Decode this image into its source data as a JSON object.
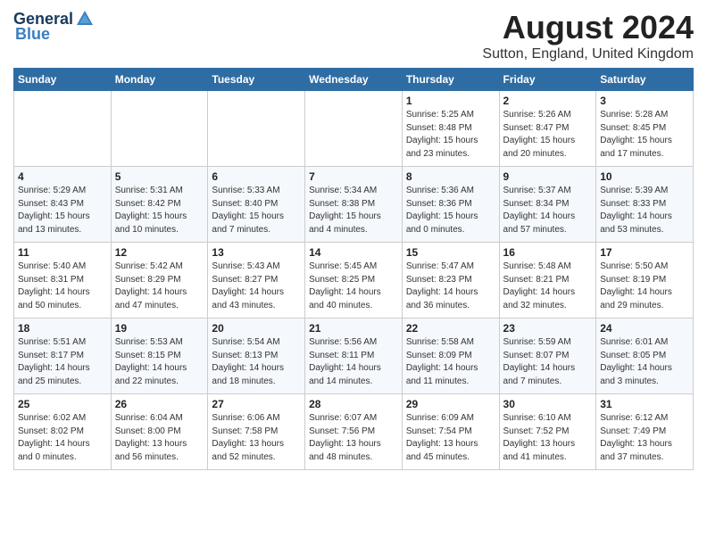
{
  "logo": {
    "general": "General",
    "blue": "Blue"
  },
  "title": "August 2024",
  "location": "Sutton, England, United Kingdom",
  "days_header": [
    "Sunday",
    "Monday",
    "Tuesday",
    "Wednesday",
    "Thursday",
    "Friday",
    "Saturday"
  ],
  "weeks": [
    [
      {
        "day": "",
        "info": ""
      },
      {
        "day": "",
        "info": ""
      },
      {
        "day": "",
        "info": ""
      },
      {
        "day": "",
        "info": ""
      },
      {
        "day": "1",
        "info": "Sunrise: 5:25 AM\nSunset: 8:48 PM\nDaylight: 15 hours\nand 23 minutes."
      },
      {
        "day": "2",
        "info": "Sunrise: 5:26 AM\nSunset: 8:47 PM\nDaylight: 15 hours\nand 20 minutes."
      },
      {
        "day": "3",
        "info": "Sunrise: 5:28 AM\nSunset: 8:45 PM\nDaylight: 15 hours\nand 17 minutes."
      }
    ],
    [
      {
        "day": "4",
        "info": "Sunrise: 5:29 AM\nSunset: 8:43 PM\nDaylight: 15 hours\nand 13 minutes."
      },
      {
        "day": "5",
        "info": "Sunrise: 5:31 AM\nSunset: 8:42 PM\nDaylight: 15 hours\nand 10 minutes."
      },
      {
        "day": "6",
        "info": "Sunrise: 5:33 AM\nSunset: 8:40 PM\nDaylight: 15 hours\nand 7 minutes."
      },
      {
        "day": "7",
        "info": "Sunrise: 5:34 AM\nSunset: 8:38 PM\nDaylight: 15 hours\nand 4 minutes."
      },
      {
        "day": "8",
        "info": "Sunrise: 5:36 AM\nSunset: 8:36 PM\nDaylight: 15 hours\nand 0 minutes."
      },
      {
        "day": "9",
        "info": "Sunrise: 5:37 AM\nSunset: 8:34 PM\nDaylight: 14 hours\nand 57 minutes."
      },
      {
        "day": "10",
        "info": "Sunrise: 5:39 AM\nSunset: 8:33 PM\nDaylight: 14 hours\nand 53 minutes."
      }
    ],
    [
      {
        "day": "11",
        "info": "Sunrise: 5:40 AM\nSunset: 8:31 PM\nDaylight: 14 hours\nand 50 minutes."
      },
      {
        "day": "12",
        "info": "Sunrise: 5:42 AM\nSunset: 8:29 PM\nDaylight: 14 hours\nand 47 minutes."
      },
      {
        "day": "13",
        "info": "Sunrise: 5:43 AM\nSunset: 8:27 PM\nDaylight: 14 hours\nand 43 minutes."
      },
      {
        "day": "14",
        "info": "Sunrise: 5:45 AM\nSunset: 8:25 PM\nDaylight: 14 hours\nand 40 minutes."
      },
      {
        "day": "15",
        "info": "Sunrise: 5:47 AM\nSunset: 8:23 PM\nDaylight: 14 hours\nand 36 minutes."
      },
      {
        "day": "16",
        "info": "Sunrise: 5:48 AM\nSunset: 8:21 PM\nDaylight: 14 hours\nand 32 minutes."
      },
      {
        "day": "17",
        "info": "Sunrise: 5:50 AM\nSunset: 8:19 PM\nDaylight: 14 hours\nand 29 minutes."
      }
    ],
    [
      {
        "day": "18",
        "info": "Sunrise: 5:51 AM\nSunset: 8:17 PM\nDaylight: 14 hours\nand 25 minutes."
      },
      {
        "day": "19",
        "info": "Sunrise: 5:53 AM\nSunset: 8:15 PM\nDaylight: 14 hours\nand 22 minutes."
      },
      {
        "day": "20",
        "info": "Sunrise: 5:54 AM\nSunset: 8:13 PM\nDaylight: 14 hours\nand 18 minutes."
      },
      {
        "day": "21",
        "info": "Sunrise: 5:56 AM\nSunset: 8:11 PM\nDaylight: 14 hours\nand 14 minutes."
      },
      {
        "day": "22",
        "info": "Sunrise: 5:58 AM\nSunset: 8:09 PM\nDaylight: 14 hours\nand 11 minutes."
      },
      {
        "day": "23",
        "info": "Sunrise: 5:59 AM\nSunset: 8:07 PM\nDaylight: 14 hours\nand 7 minutes."
      },
      {
        "day": "24",
        "info": "Sunrise: 6:01 AM\nSunset: 8:05 PM\nDaylight: 14 hours\nand 3 minutes."
      }
    ],
    [
      {
        "day": "25",
        "info": "Sunrise: 6:02 AM\nSunset: 8:02 PM\nDaylight: 14 hours\nand 0 minutes."
      },
      {
        "day": "26",
        "info": "Sunrise: 6:04 AM\nSunset: 8:00 PM\nDaylight: 13 hours\nand 56 minutes."
      },
      {
        "day": "27",
        "info": "Sunrise: 6:06 AM\nSunset: 7:58 PM\nDaylight: 13 hours\nand 52 minutes."
      },
      {
        "day": "28",
        "info": "Sunrise: 6:07 AM\nSunset: 7:56 PM\nDaylight: 13 hours\nand 48 minutes."
      },
      {
        "day": "29",
        "info": "Sunrise: 6:09 AM\nSunset: 7:54 PM\nDaylight: 13 hours\nand 45 minutes."
      },
      {
        "day": "30",
        "info": "Sunrise: 6:10 AM\nSunset: 7:52 PM\nDaylight: 13 hours\nand 41 minutes."
      },
      {
        "day": "31",
        "info": "Sunrise: 6:12 AM\nSunset: 7:49 PM\nDaylight: 13 hours\nand 37 minutes."
      }
    ]
  ]
}
